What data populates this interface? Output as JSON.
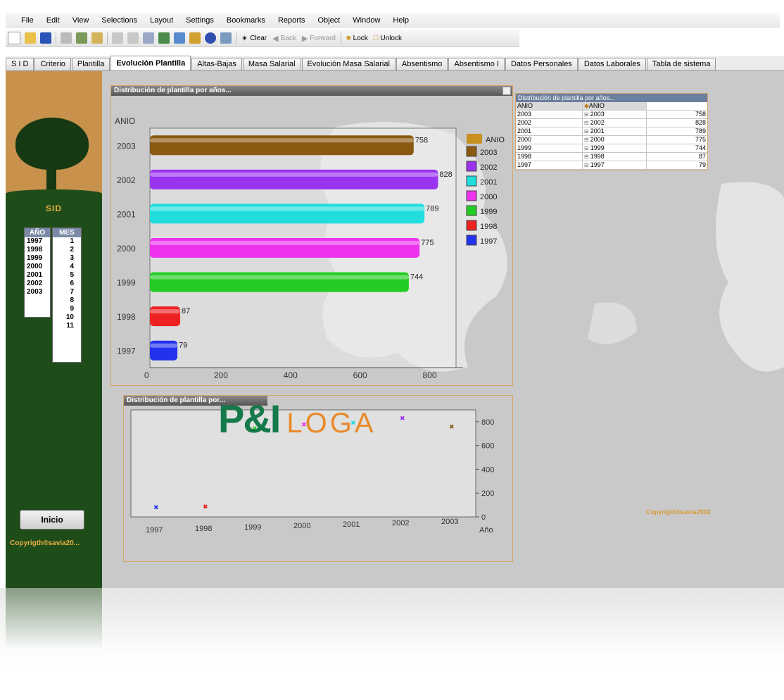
{
  "menu": [
    "File",
    "Edit",
    "View",
    "Selections",
    "Layout",
    "Settings",
    "Bookmarks",
    "Reports",
    "Object",
    "Window",
    "Help"
  ],
  "toolbar": {
    "clear": "Clear",
    "back": "Back",
    "forward": "Forward",
    "lock": "Lock",
    "unlock": "Unlock"
  },
  "tabs": [
    "S I D",
    "Criterio",
    "Plantilla",
    "Evolución Plantilla",
    "Altas-Bajas",
    "Masa Salarial",
    "Evolución Masa Salarial",
    "Absentismo",
    "Absentismo I",
    "Datos Personales",
    "Datos Laborales",
    "Tabla de sistema"
  ],
  "active_tab": "Evolución Plantilla",
  "sidebar": {
    "label": "SID",
    "anio_header": "AÑO",
    "mes_header": "MES",
    "anios": [
      "1997",
      "1998",
      "1999",
      "2000",
      "2001",
      "2002",
      "2003"
    ],
    "meses": [
      "1",
      "2",
      "3",
      "4",
      "5",
      "6",
      "7",
      "8",
      "9",
      "10",
      "11"
    ],
    "inicio": "Inicio",
    "copyright": "Copyrigth®savia20..."
  },
  "bar_panel": {
    "title": "Distribución de plantilla por años...",
    "axis_label": "ANIO",
    "legend_title": "ANIO"
  },
  "table_panel": {
    "title": "Distribución de plantilla por años...",
    "col1": "ANIO",
    "col2": "ANIO",
    "rows": [
      {
        "anio": "2003",
        "val": "2003",
        "n": "758"
      },
      {
        "anio": "2002",
        "val": "2002",
        "n": "828"
      },
      {
        "anio": "2001",
        "val": "2001",
        "n": "789"
      },
      {
        "anio": "2000",
        "val": "2000",
        "n": "775"
      },
      {
        "anio": "1999",
        "val": "1999",
        "n": "744"
      },
      {
        "anio": "1998",
        "val": "1998",
        "n": "87"
      },
      {
        "anio": "1997",
        "val": "1997",
        "n": "79"
      }
    ]
  },
  "scatter_panel": {
    "title": "Distribución de plantilla por...",
    "xlabel": "Año"
  },
  "logo": {
    "pi": "P&I",
    "loga": "LOGA"
  },
  "copyright_right": "Copyrigth®savia2002",
  "colors": {
    "2003": "#8a5a12",
    "2002": "#9933ee",
    "2001": "#22dddd",
    "2000": "#ee33ee",
    "1999": "#22cc22",
    "1998": "#ee2222",
    "1997": "#2233ee"
  },
  "chart_data": [
    {
      "type": "bar",
      "title": "Distribución de plantilla por años...",
      "categories": [
        "2003",
        "2002",
        "2001",
        "2000",
        "1999",
        "1998",
        "1997"
      ],
      "values": [
        758,
        828,
        789,
        775,
        744,
        87,
        79
      ],
      "ylabel": "ANIO",
      "xlim": [
        0,
        900
      ],
      "xticks": [
        "0",
        "200",
        "400",
        "600",
        "800"
      ],
      "legend": [
        "2003",
        "2002",
        "2001",
        "2000",
        "1999",
        "1998",
        "1997"
      ],
      "legend_position": "right"
    },
    {
      "type": "scatter",
      "title": "Distribución de plantilla por...",
      "x": [
        "1997",
        "1998",
        "1999",
        "2000",
        "2001",
        "2002",
        "2003"
      ],
      "values": [
        79,
        87,
        744,
        775,
        789,
        828,
        758
      ],
      "xlabel": "Año",
      "ylim": [
        0,
        900
      ],
      "yticks": [
        "0",
        "200",
        "400",
        "600",
        "800"
      ],
      "yaxis_position": "right"
    }
  ]
}
